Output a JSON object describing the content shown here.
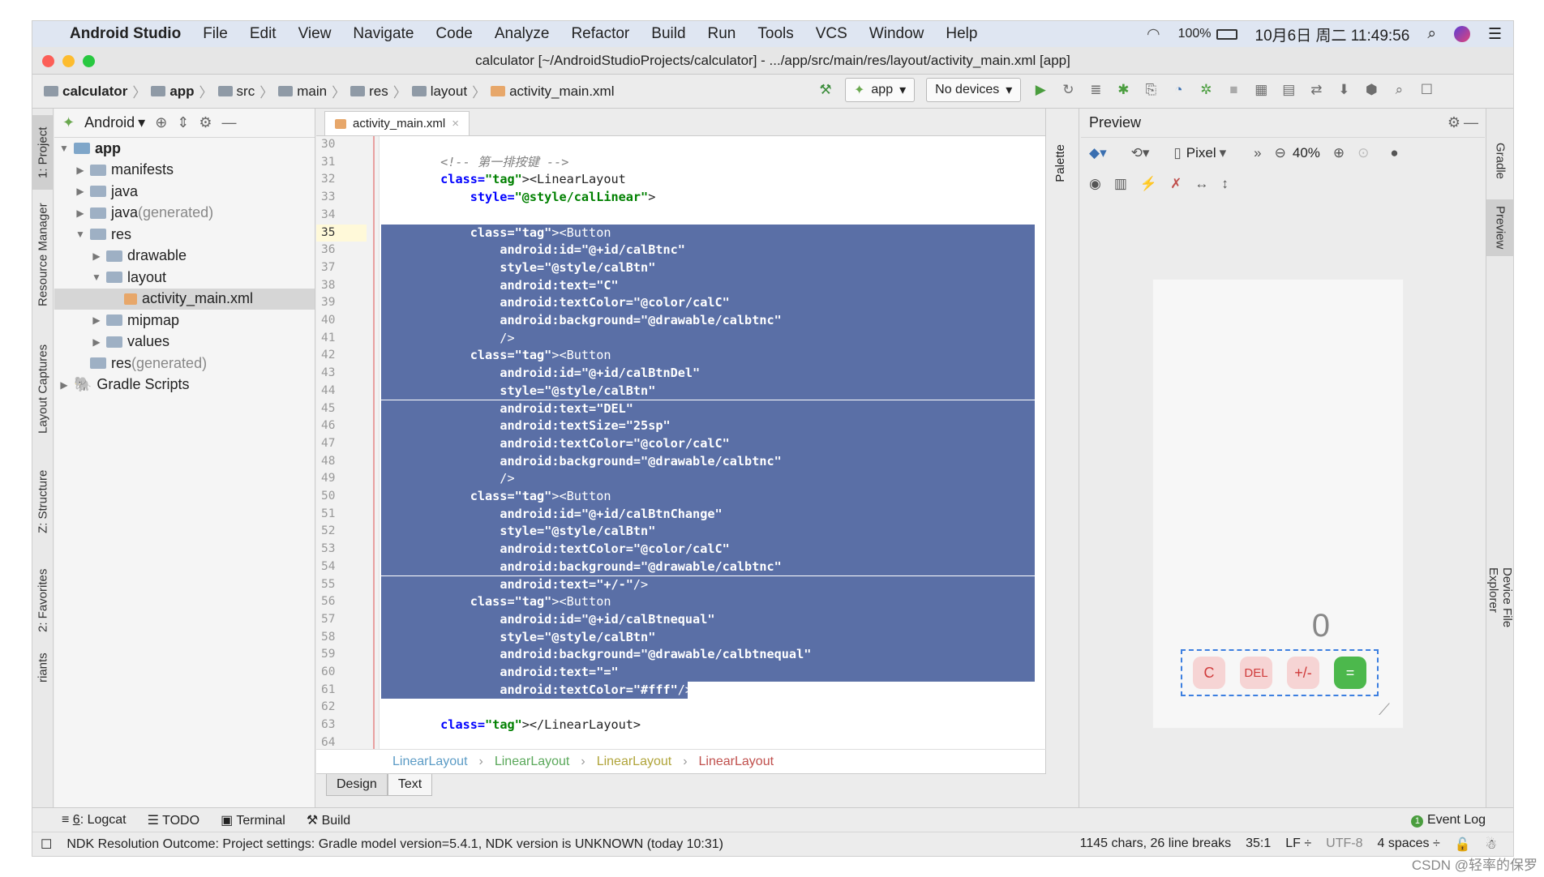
{
  "menubar": {
    "app_name": "Android Studio",
    "items": [
      "File",
      "Edit",
      "View",
      "Navigate",
      "Code",
      "Analyze",
      "Refactor",
      "Build",
      "Run",
      "Tools",
      "VCS",
      "Window",
      "Help"
    ],
    "battery": "100%",
    "datetime": "10月6日 周二  11:49:56"
  },
  "window": {
    "title": "calculator [~/AndroidStudioProjects/calculator] - .../app/src/main/res/layout/activity_main.xml [app]"
  },
  "navbar": {
    "breadcrumbs": [
      "calculator",
      "app",
      "src",
      "main",
      "res",
      "layout",
      "activity_main.xml"
    ],
    "run_config": "app",
    "device": "No devices"
  },
  "left_tabs": [
    "1: Project",
    "Resource Manager",
    "Layout Captures",
    "Z: Structure",
    "2: Favorites",
    "riants"
  ],
  "project": {
    "view_mode": "Android",
    "tree": [
      {
        "label": "app",
        "suffix": "",
        "level": 0,
        "expanded": true
      },
      {
        "label": "manifests",
        "suffix": "",
        "level": 1,
        "expanded": false
      },
      {
        "label": "java",
        "suffix": "",
        "level": 1,
        "expanded": false
      },
      {
        "label": "java",
        "suffix": " (generated)",
        "level": 1,
        "expanded": false
      },
      {
        "label": "res",
        "suffix": "",
        "level": 1,
        "expanded": true
      },
      {
        "label": "drawable",
        "suffix": "",
        "level": 2,
        "expanded": false
      },
      {
        "label": "layout",
        "suffix": "",
        "level": 2,
        "expanded": true
      },
      {
        "label": "activity_main.xml",
        "suffix": "",
        "level": 3,
        "selected": true
      },
      {
        "label": "mipmap",
        "suffix": "",
        "level": 2,
        "expanded": false
      },
      {
        "label": "values",
        "suffix": "",
        "level": 2,
        "expanded": false
      },
      {
        "label": "res",
        "suffix": " (generated)",
        "level": 1
      },
      {
        "label": "Gradle Scripts",
        "suffix": "",
        "level": 0,
        "expanded": false
      }
    ]
  },
  "editor": {
    "tab": "activity_main.xml",
    "first_line": 30,
    "current_line": 35,
    "lines": [
      "",
      "        <!-- 第一排按键 -->",
      "        <LinearLayout",
      "            style=\"@style/calLinear\">",
      "",
      "            <Button",
      "                android:id=\"@+id/calBtnc\"",
      "                style=\"@style/calBtn\"",
      "                android:text=\"C\"",
      "                android:textColor=\"@color/calC\"",
      "                android:background=\"@drawable/calbtnc\"",
      "                />",
      "            <Button",
      "                android:id=\"@+id/calBtnDel\"",
      "                style=\"@style/calBtn\"",
      "                android:text=\"DEL\"",
      "                android:textSize=\"25sp\"",
      "                android:textColor=\"@color/calC\"",
      "                android:background=\"@drawable/calbtnc\"",
      "                />",
      "            <Button",
      "                android:id=\"@+id/calBtnChange\"",
      "                style=\"@style/calBtn\"",
      "                android:textColor=\"@color/calC\"",
      "                android:background=\"@drawable/calbtnc\"",
      "                android:text=\"+/-\"/>",
      "            <Button",
      "                android:id=\"@+id/calBtnequal\"",
      "                style=\"@style/calBtn\"",
      "                android:background=\"@drawable/calbtnequal\"",
      "                android:text=\"=\"",
      "                android:textColor=\"#fff\"/>",
      "",
      "        </LinearLayout>",
      ""
    ],
    "breadcrumb": [
      "LinearLayout",
      "LinearLayout",
      "LinearLayout",
      "LinearLayout"
    ],
    "bottom_tabs": [
      "Design",
      "Text"
    ]
  },
  "preview": {
    "title": "Preview",
    "palette_label": "Palette",
    "device": "Pixel",
    "zoom": "40%",
    "display_value": "0",
    "buttons": [
      "C",
      "DEL",
      "+/-",
      "="
    ],
    "colors": {
      "button_bg": "#f6d4d4",
      "button_text": "#d03b3b",
      "equal_bg": "#4cb84c"
    }
  },
  "right_tabs": [
    "Gradle",
    "Preview",
    "Device File Explorer"
  ],
  "bottom_tools": [
    {
      "num": "6",
      "label": ": Logcat"
    },
    {
      "num": "",
      "label": "TODO"
    },
    {
      "num": "",
      "label": "Terminal"
    },
    {
      "num": "",
      "label": "Build"
    }
  ],
  "event_log": "Event Log",
  "status": {
    "message": "NDK Resolution Outcome: Project settings: Gradle model version=5.4.1, NDK version is UNKNOWN (today 10:31)",
    "chars": "1145 chars, 26 line breaks",
    "position": "35:1",
    "line_sep": "LF ÷",
    "encoding": "UTF-8",
    "indent": "4 spaces ÷"
  },
  "watermark": "CSDN @轻率的保罗"
}
